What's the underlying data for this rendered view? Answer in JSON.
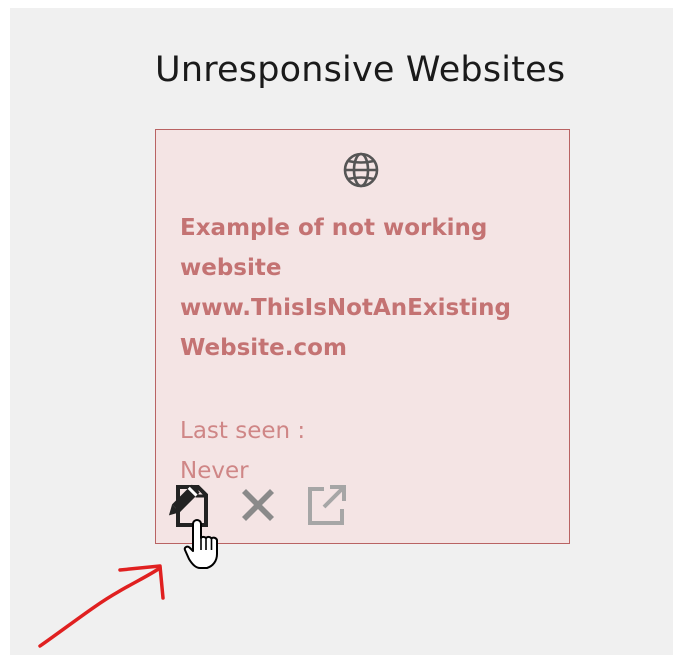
{
  "page": {
    "title": "Unresponsive Websites"
  },
  "card": {
    "icon": "globe-icon",
    "title_lines": [
      "Example of not working",
      "website",
      "www.ThisIsNotAnExisting",
      "Website.com"
    ],
    "last_seen_label": "Last seen :",
    "last_seen_value": "Never",
    "actions": [
      {
        "name": "edit",
        "icon": "edit-document-icon"
      },
      {
        "name": "delete",
        "icon": "close-x-icon"
      },
      {
        "name": "open",
        "icon": "external-link-icon"
      }
    ]
  },
  "colors": {
    "background": "#f0f0f0",
    "card_background": "#f4e4e4",
    "card_border": "#b96363",
    "title_text": "#c47373",
    "muted_text": "#cf8686",
    "annotation": "#e02020"
  },
  "annotation": {
    "icon": "red-arrow-annotation",
    "cursor": "hand-pointer-cursor-icon"
  }
}
